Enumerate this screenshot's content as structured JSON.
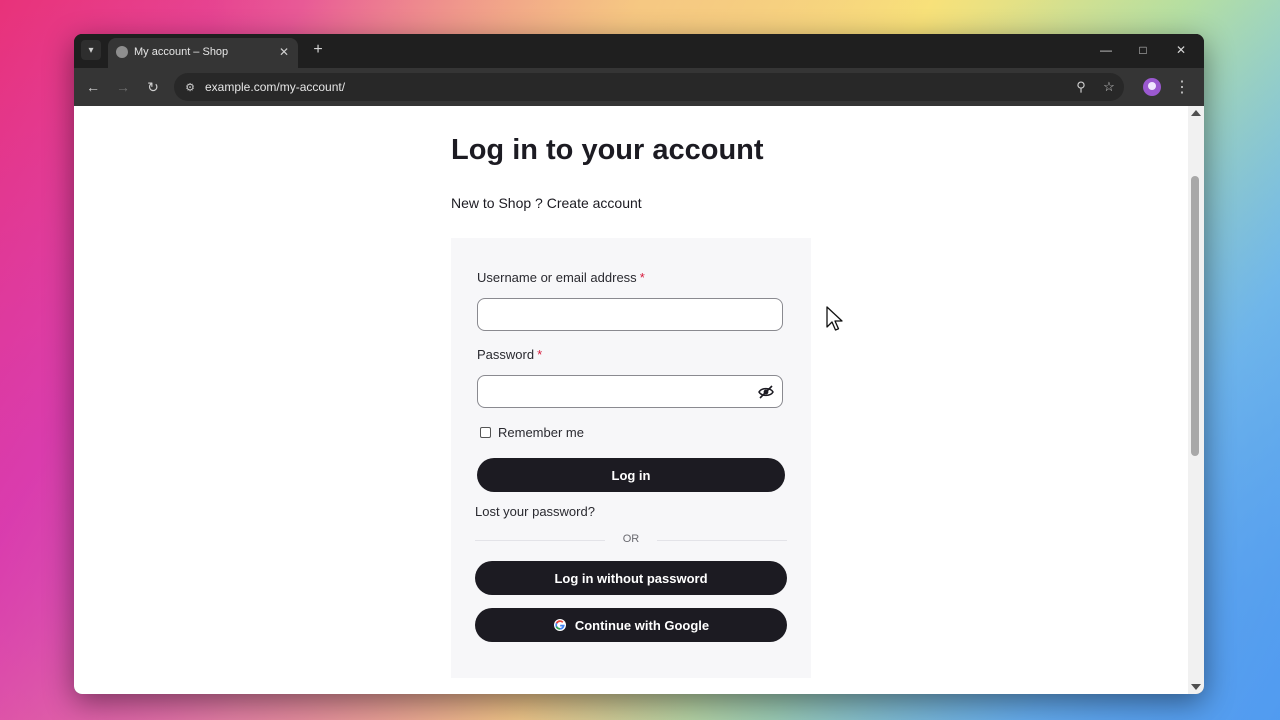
{
  "browser": {
    "tab_title": "My account – Shop",
    "url": "example.com/my-account/"
  },
  "page": {
    "heading": "Log in to your account",
    "signup_prompt": "New to Shop ? Create account",
    "username_label": "Username or email address",
    "username_value": "",
    "password_label": "Password",
    "password_value": "",
    "required_marker": "*",
    "remember_label": "Remember me",
    "remember_checked": false,
    "login_button": "Log in",
    "lost_password": "Lost your password?",
    "divider_text": "OR",
    "passwordless_button": "Log in without password",
    "google_button": "Continue with Google"
  },
  "colors": {
    "accent": "#1c1b22",
    "required": "#d6183a",
    "card_bg": "#f7f7f9"
  },
  "icons": [
    "tab-dropdown-icon",
    "globe-icon",
    "close-icon",
    "plus-icon",
    "minimize-icon",
    "maximize-icon",
    "back-icon",
    "forward-icon",
    "reload-icon",
    "site-info-icon",
    "zoom-icon",
    "star-icon",
    "profile-icon",
    "menu-icon",
    "eye-off-icon",
    "google-icon",
    "cursor-icon"
  ]
}
